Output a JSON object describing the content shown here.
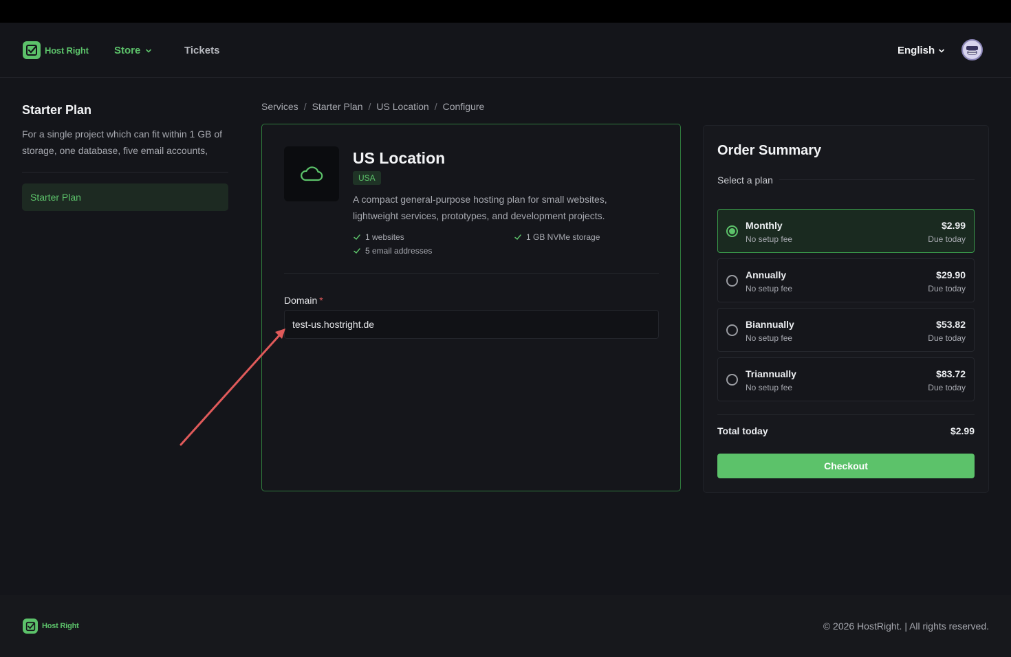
{
  "app": {
    "brand": "Host Right",
    "accent_color": "#5cc26a"
  },
  "header": {
    "nav_store": "Store",
    "nav_tickets": "Tickets",
    "language": "English"
  },
  "sidebar": {
    "title": "Starter Plan",
    "description": "For a single project which can fit within 1 GB of storage, one database, five email accounts,",
    "items": [
      {
        "label": "Starter Plan",
        "active": true
      }
    ]
  },
  "breadcrumb": [
    "Services",
    "Starter Plan",
    "US Location",
    "Configure"
  ],
  "product": {
    "icon": "cloud-icon",
    "title": "US Location",
    "badge": "USA",
    "description": "A compact general-purpose hosting plan for small websites, lightweight services, prototypes, and development projects.",
    "features": [
      "1 websites",
      "1 GB NVMe storage",
      "5 email addresses"
    ],
    "domain_label": "Domain",
    "domain_required_mark": "*",
    "domain_value": "test-us.hostright.de"
  },
  "summary": {
    "title": "Order Summary",
    "select_label": "Select a plan",
    "plans": [
      {
        "name": "Monthly",
        "fee": "No setup fee",
        "price": "$2.99",
        "due": "Due today",
        "selected": true
      },
      {
        "name": "Annually",
        "fee": "No setup fee",
        "price": "$29.90",
        "due": "Due today",
        "selected": false
      },
      {
        "name": "Biannually",
        "fee": "No setup fee",
        "price": "$53.82",
        "due": "Due today",
        "selected": false
      },
      {
        "name": "Triannually",
        "fee": "No setup fee",
        "price": "$83.72",
        "due": "Due today",
        "selected": false
      }
    ],
    "total_label": "Total today",
    "total_value": "$2.99",
    "checkout_label": "Checkout"
  },
  "footer": {
    "brand": "Host Right",
    "copyright": "© 2026 HostRight. | All rights reserved."
  },
  "annotation": {
    "arrow_color": "#e05a5a"
  }
}
